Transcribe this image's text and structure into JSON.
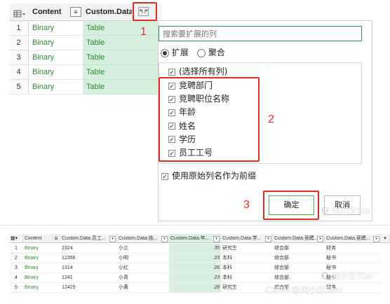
{
  "top_grid": {
    "columns": [
      "Content",
      "Custom.Data"
    ],
    "rows": [
      {
        "n": "1",
        "content": "Binary",
        "data": "Table"
      },
      {
        "n": "2",
        "content": "Binary",
        "data": "Table"
      },
      {
        "n": "3",
        "content": "Binary",
        "data": "Table"
      },
      {
        "n": "4",
        "content": "Binary",
        "data": "Table"
      },
      {
        "n": "5",
        "content": "Binary",
        "data": "Table"
      }
    ]
  },
  "dialog": {
    "search_placeholder": "搜索要扩展的列",
    "mode_options": [
      "扩展",
      "聚合"
    ],
    "select_all_label": "(选择所有列)",
    "columns": [
      "竞聘部门",
      "竞聘职位名称",
      "年龄",
      "姓名",
      "学历",
      "员工工号"
    ],
    "prefix_label": "使用原始列名作为前缀",
    "ok_label": "确定",
    "cancel_label": "取消"
  },
  "annotations": [
    "1",
    "2",
    "3"
  ],
  "bottom_table": {
    "headers": [
      "Content",
      "Custom.Data.员工...",
      "Custom.Data.姓...",
      "Custom.Data.年...",
      "Custom.Data.学...",
      "Custom.Data.竞聘...",
      "Custom.Data.竞聘..."
    ],
    "rows": [
      {
        "n": "1",
        "content": "Binary",
        "id": "2324",
        "name": "小兰",
        "age": "35",
        "edu": "研究生",
        "dept": "综合部",
        "pos": "财务"
      },
      {
        "n": "2",
        "content": "Binary",
        "id": "12356",
        "name": "小明",
        "age": "23",
        "edu": "本科",
        "dept": "综合部",
        "pos": "秘书"
      },
      {
        "n": "3",
        "content": "Binary",
        "id": "1314",
        "name": "小红",
        "age": "26",
        "edu": "本科",
        "dept": "综合部",
        "pos": "秘书"
      },
      {
        "n": "4",
        "content": "Binary",
        "id": "1241",
        "name": "小青",
        "age": "23",
        "edu": "本科",
        "dept": "综合部",
        "pos": "秘书"
      },
      {
        "n": "5",
        "content": "Binary",
        "id": "12425",
        "name": "小黄",
        "age": "28",
        "edu": "研究生",
        "dept": "综合部",
        "pos": "财务"
      }
    ]
  },
  "watermarks": [
    "刘小生Star",
    "刘小生Star",
    "CSDN @刘小生Star"
  ],
  "colors": {
    "accent_red": "#e52a22",
    "table_green": "#2e8b2e",
    "column_highlight": "#d6efde",
    "ok_border": "#4caf50"
  }
}
